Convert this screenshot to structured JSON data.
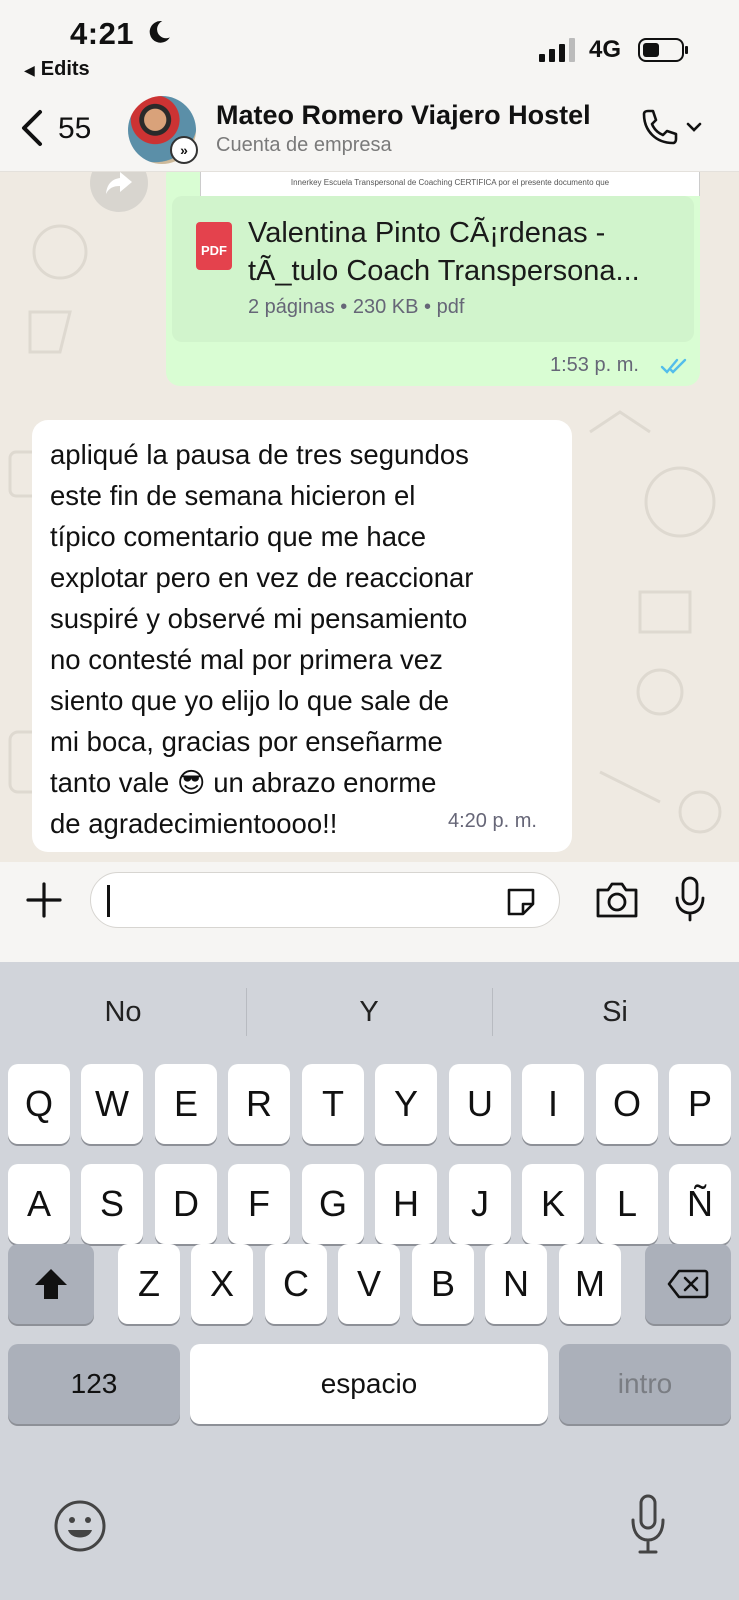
{
  "status_bar": {
    "time": "4:21",
    "back_app": "Edits",
    "network": "4G",
    "icons": [
      "moon-icon",
      "signal-icon",
      "battery-icon"
    ]
  },
  "header": {
    "back_count": "55",
    "contact_name": "Mateo Romero Viajero Hostel",
    "contact_subtitle": "Cuenta de empresa",
    "icons": [
      "back-chevron-icon",
      "business-badge-icon",
      "phone-icon",
      "chevron-down-icon"
    ]
  },
  "messages": {
    "outgoing_doc": {
      "preview_text": "Innerkey Escuela Transpersonal de Coaching CERTIFICA por el presente documento que",
      "file_icon_label": "PDF",
      "title_line1": "Valentina Pinto CÃ¡rdenas -",
      "title_line2": "tÃ_tulo Coach Transpersona...",
      "meta": "2 páginas • 230 KB • pdf",
      "time": "1:53 p. m.",
      "status_icon": "double-check-read-icon"
    },
    "incoming": {
      "lines": [
        "apliqué la pausa de tres segundos",
        "este fin de semana hicieron el",
        "típico comentario que me hace",
        "explotar pero en vez de reaccionar",
        "suspiré y observé mi pensamiento",
        "no contesté mal por primera vez",
        "siento que yo elijo lo que sale de",
        "mi boca, gracias por enseñarme",
        "tanto vale 😎 un abrazo enorme",
        "de agradecimientoooo!!"
      ],
      "time": "4:20 p. m."
    }
  },
  "composer": {
    "input_value": "",
    "icons": [
      "plus-icon",
      "sticker-icon",
      "camera-icon",
      "microphone-icon"
    ]
  },
  "keyboard": {
    "suggestions": [
      "No",
      "Y",
      "Si"
    ],
    "row1": [
      "Q",
      "W",
      "E",
      "R",
      "T",
      "Y",
      "U",
      "I",
      "O",
      "P"
    ],
    "row2": [
      "A",
      "S",
      "D",
      "F",
      "G",
      "H",
      "J",
      "K",
      "L",
      "Ñ"
    ],
    "row3": [
      "Z",
      "X",
      "C",
      "V",
      "B",
      "N",
      "M"
    ],
    "numbers_key": "123",
    "space_key": "espacio",
    "return_key": "intro",
    "icons": [
      "shift-icon",
      "backspace-icon",
      "emoji-icon",
      "dictation-icon"
    ]
  },
  "colors": {
    "chat_bg": "#efeae2",
    "outgoing_bubble": "#d9fdd3",
    "read_ticks": "#53bdeb",
    "pdf_red": "#e4424d",
    "keyboard_bg": "#d1d4da"
  }
}
